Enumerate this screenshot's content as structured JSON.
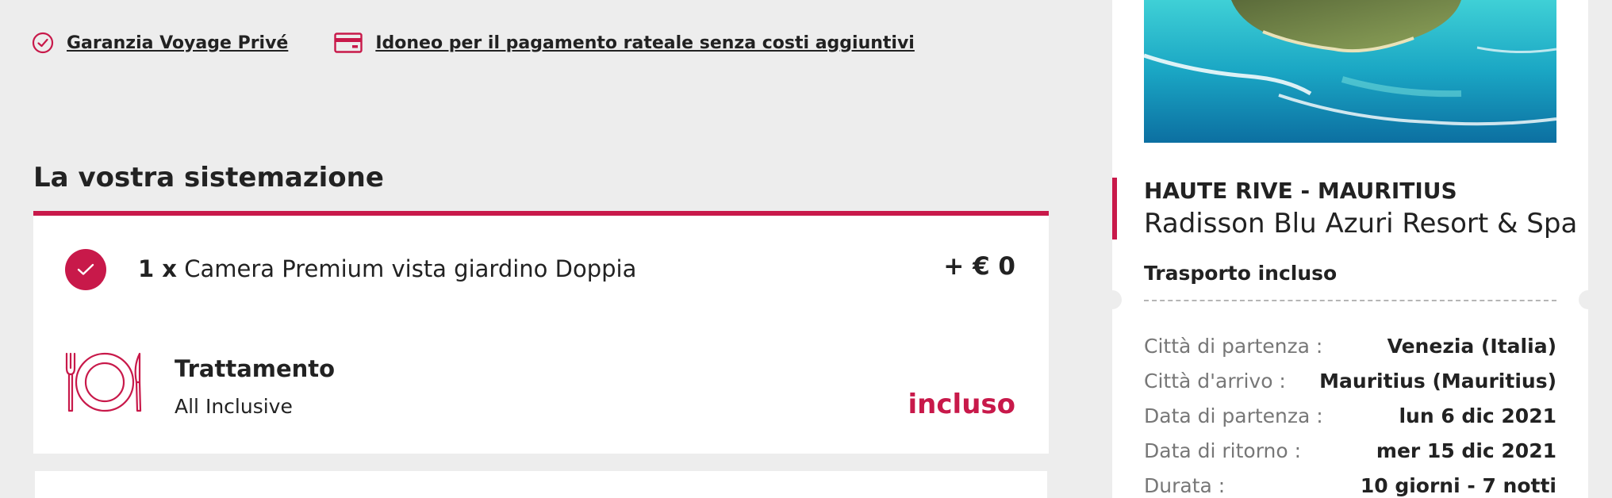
{
  "guarantees": [
    {
      "icon": "check-circle-icon",
      "label": "Garanzia Voyage Privé"
    },
    {
      "icon": "credit-card-icon",
      "label": "Idoneo per il pagamento rateale senza costi aggiuntivi"
    }
  ],
  "accommodation": {
    "section_title": "La vostra sistemazione",
    "room": {
      "quantity": "1 x",
      "name": "Camera Premium vista giardino Doppia",
      "price": "+ € 0"
    },
    "meal": {
      "title": "Trattamento",
      "plan": "All Inclusive",
      "status": "incluso"
    }
  },
  "summary": {
    "destination": "HAUTE RIVE - MAURITIUS",
    "hotel": "Radisson Blu Azuri Resort & Spa",
    "transport": "Trasporto incluso",
    "details": [
      {
        "label": "Città di partenza :",
        "value": "Venezia (Italia)"
      },
      {
        "label": "Città d'arrivo :",
        "value": "Mauritius (Mauritius)"
      },
      {
        "label": "Data di partenza :",
        "value": "lun 6 dic 2021"
      },
      {
        "label": "Data di ritorno :",
        "value": "mer 15 dic 2021"
      },
      {
        "label": "Durata :",
        "value": "10 giorni - 7 notti"
      }
    ]
  },
  "colors": {
    "accent": "#c8194a",
    "background": "#ededed"
  }
}
